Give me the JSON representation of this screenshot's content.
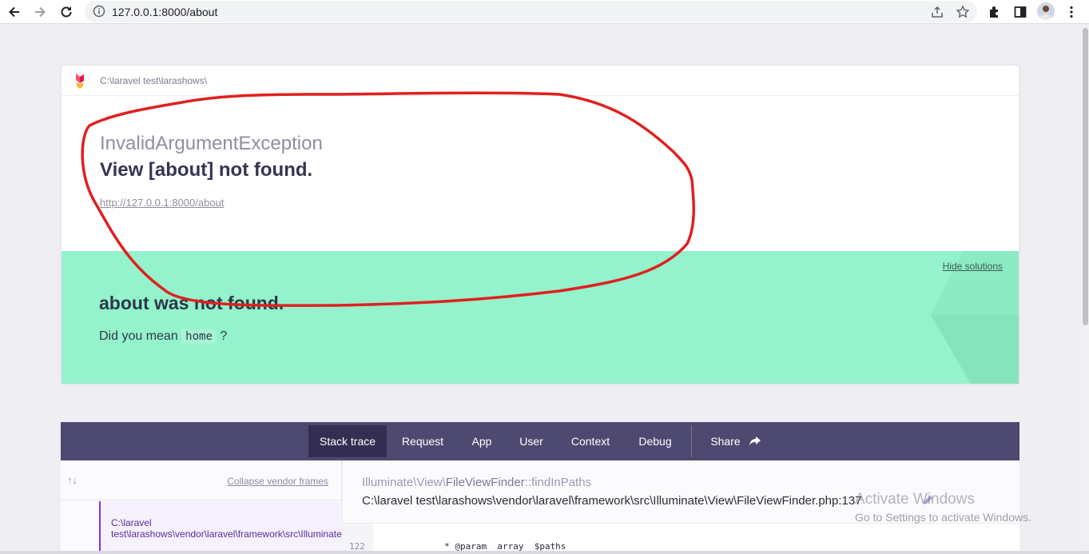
{
  "browser": {
    "url": "127.0.0.1:8000/about"
  },
  "error": {
    "app_path": "C:\\laravel test\\larashows\\",
    "exception_class": "InvalidArgumentException",
    "message": "View [about] not found.",
    "url": "http://127.0.0.1:8000/about"
  },
  "solution": {
    "hide_label": "Hide solutions",
    "title": "about was not found.",
    "text_before": "Did you mean",
    "suggestion": "home",
    "text_after": "?"
  },
  "tabs": {
    "items": [
      {
        "label": "Stack trace",
        "active": true
      },
      {
        "label": "Request",
        "active": false
      },
      {
        "label": "App",
        "active": false
      },
      {
        "label": "User",
        "active": false
      },
      {
        "label": "Context",
        "active": false
      },
      {
        "label": "Debug",
        "active": false
      }
    ],
    "share_label": "Share"
  },
  "stack": {
    "arrows": "↑↓",
    "collapse_label": "Collapse vendor frames",
    "frame_path": "C:\\laravel test\\larashows\\vendor\\laravel\\framework\\src\\Illuminate\\View\\FileViewFinder.php",
    "frame_ns": "Illuminate\\View\\",
    "frame_class": "FileViewFinder",
    "frame_method": "::findInPaths",
    "frame_file": "C:\\laravel test\\larashows\\vendor\\laravel\\framework\\src\\Illuminate\\View\\FileViewFinder.php:137",
    "line_number": "122",
    "code": "     * @param  array  $paths"
  },
  "watermark": {
    "title": "Activate Windows",
    "subtitle": "Go to Settings to activate Windows."
  },
  "colors": {
    "solution_bg": "#94f2cc",
    "tabs_bg": "#4e4970",
    "annotation": "#e02020"
  }
}
